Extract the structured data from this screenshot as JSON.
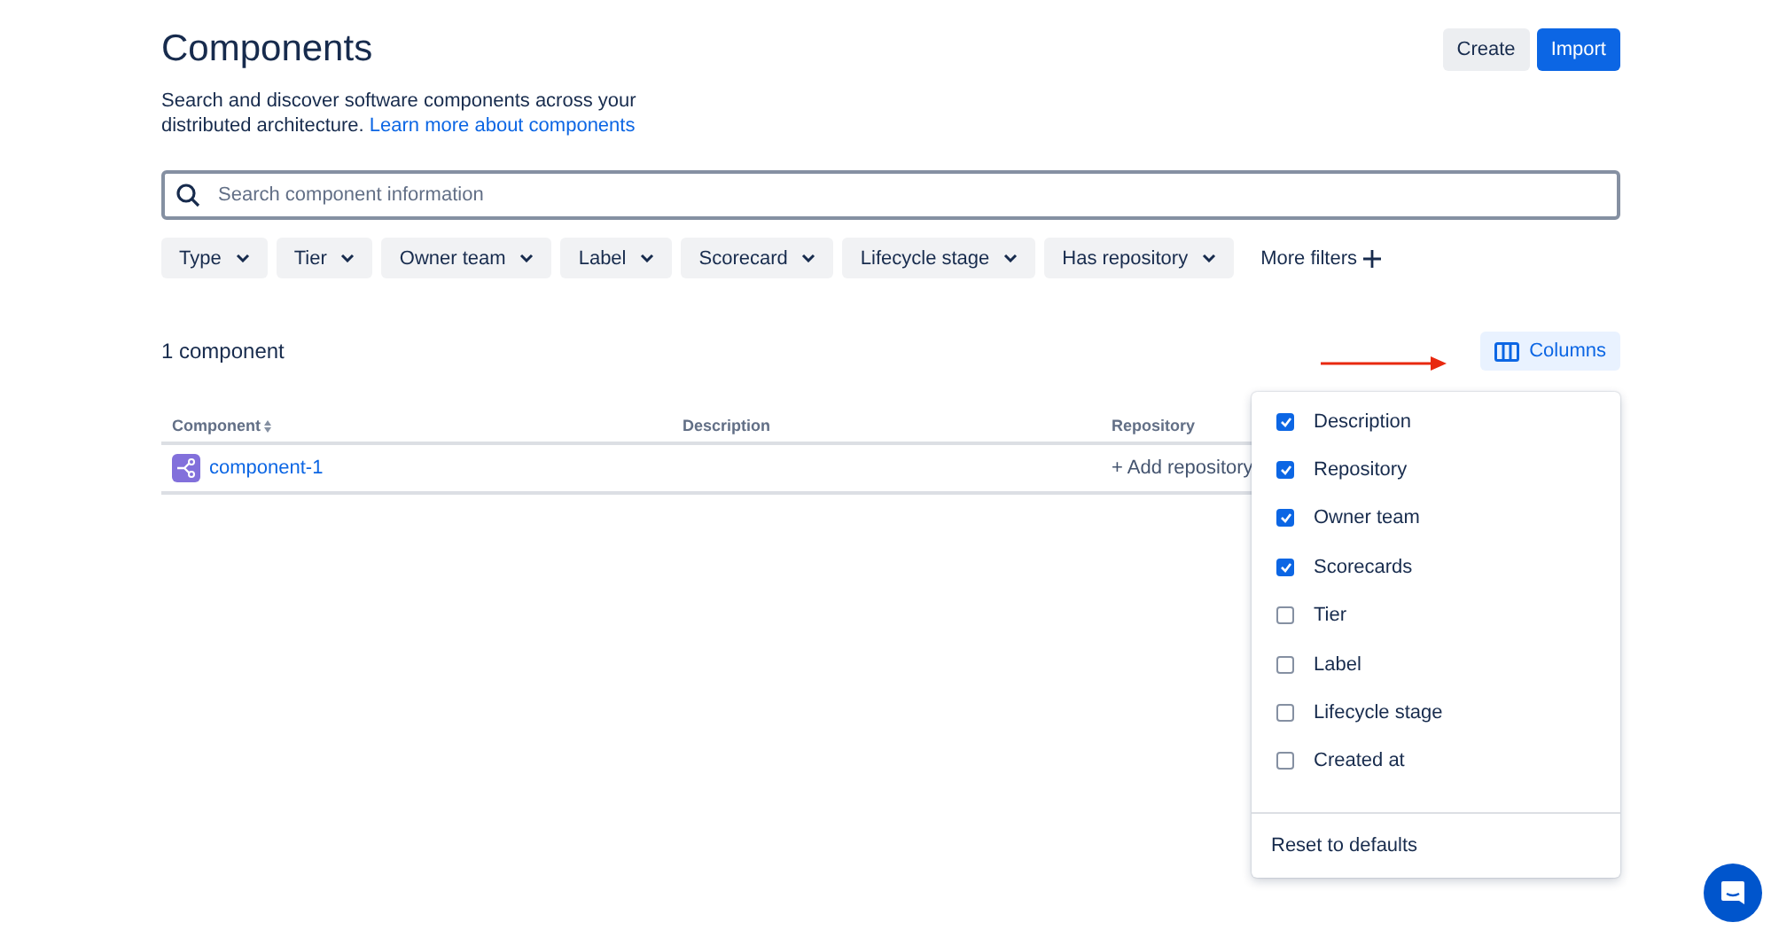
{
  "header": {
    "title": "Components",
    "buttons": [
      {
        "label": "Create",
        "kind": "default"
      },
      {
        "label": "Import",
        "kind": "primary"
      }
    ]
  },
  "intro": {
    "text": "Search and discover software components across your distributed architecture.",
    "link": "Learn more about components"
  },
  "search": {
    "placeholder": "Search component information"
  },
  "filters": [
    "Type",
    "Tier",
    "Owner team",
    "Label",
    "Scorecard",
    "Lifecycle stage",
    "Has repository"
  ],
  "more_filters": "More filters",
  "count": "1 component",
  "columns_button": "Columns",
  "table": {
    "columns": [
      "Component",
      "Description",
      "Repository"
    ],
    "rows": [
      {
        "name": "component-1",
        "description": "",
        "repository": "+ Add repository"
      }
    ]
  },
  "columns_menu": {
    "items": [
      {
        "label": "Description",
        "checked": true
      },
      {
        "label": "Repository",
        "checked": true
      },
      {
        "label": "Owner team",
        "checked": true
      },
      {
        "label": "Scorecards",
        "checked": true
      },
      {
        "label": "Tier",
        "checked": false
      },
      {
        "label": "Label",
        "checked": false
      },
      {
        "label": "Lifecycle stage",
        "checked": false
      },
      {
        "label": "Created at",
        "checked": false
      }
    ],
    "reset": "Reset to defaults"
  }
}
